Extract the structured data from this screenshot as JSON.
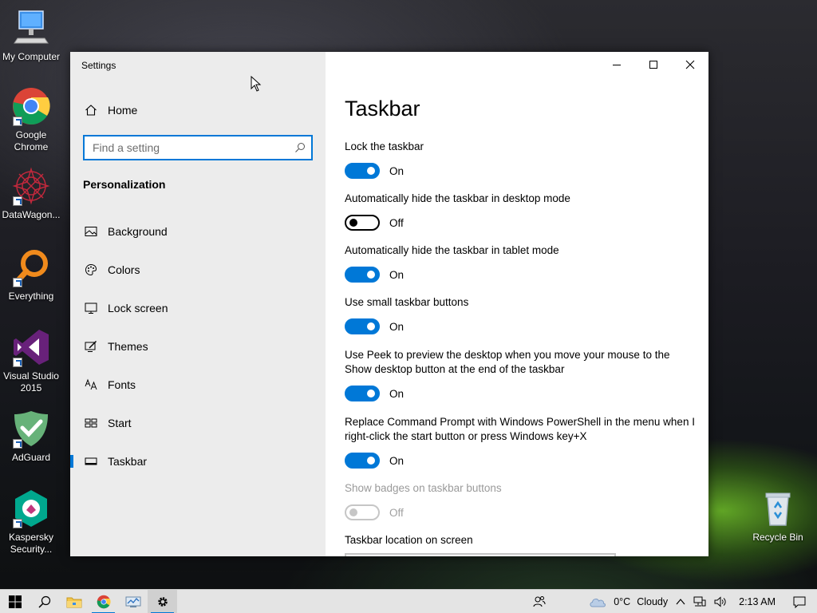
{
  "desktop": {
    "icons": [
      {
        "label": "My Computer"
      },
      {
        "label": "Google Chrome"
      },
      {
        "label": "DataWagon..."
      },
      {
        "label": "Everything"
      },
      {
        "label": "Visual Studio 2015"
      },
      {
        "label": "AdGuard"
      },
      {
        "label": "Kaspersky Security..."
      },
      {
        "label": "Recycle Bin"
      }
    ]
  },
  "window": {
    "title": "Settings",
    "sidebar": {
      "home_label": "Home",
      "search_placeholder": "Find a setting",
      "section_title": "Personalization",
      "items": [
        {
          "label": "Background",
          "icon": "image-icon"
        },
        {
          "label": "Colors",
          "icon": "palette-icon"
        },
        {
          "label": "Lock screen",
          "icon": "monitor-icon"
        },
        {
          "label": "Themes",
          "icon": "brush-icon"
        },
        {
          "label": "Fonts",
          "icon": "font-icon"
        },
        {
          "label": "Start",
          "icon": "start-grid-icon"
        },
        {
          "label": "Taskbar",
          "icon": "taskbar-icon",
          "active": true
        }
      ]
    },
    "main": {
      "title": "Taskbar",
      "settings": [
        {
          "label": "Lock the taskbar",
          "state": "On"
        },
        {
          "label": "Automatically hide the taskbar in desktop mode",
          "state": "Off"
        },
        {
          "label": "Automatically hide the taskbar in tablet mode",
          "state": "On"
        },
        {
          "label": "Use small taskbar buttons",
          "state": "On"
        },
        {
          "label": "Use Peek to preview the desktop when you move your mouse to the Show desktop button at the end of the taskbar",
          "state": "On"
        },
        {
          "label": "Replace Command Prompt with Windows PowerShell in the menu when I right-click the start button or press Windows key+X",
          "state": "On"
        },
        {
          "label": "Show badges on taskbar buttons",
          "state": "Off",
          "disabled": true
        }
      ],
      "location_label": "Taskbar location on screen"
    }
  },
  "taskbar": {
    "weather": {
      "temp": "0°C",
      "condition": "Cloudy"
    },
    "clock": "2:13 AM"
  },
  "colors": {
    "accent": "#0078d7",
    "sidebar_bg": "#ececec",
    "taskbar_bg": "#e4e4e4"
  }
}
